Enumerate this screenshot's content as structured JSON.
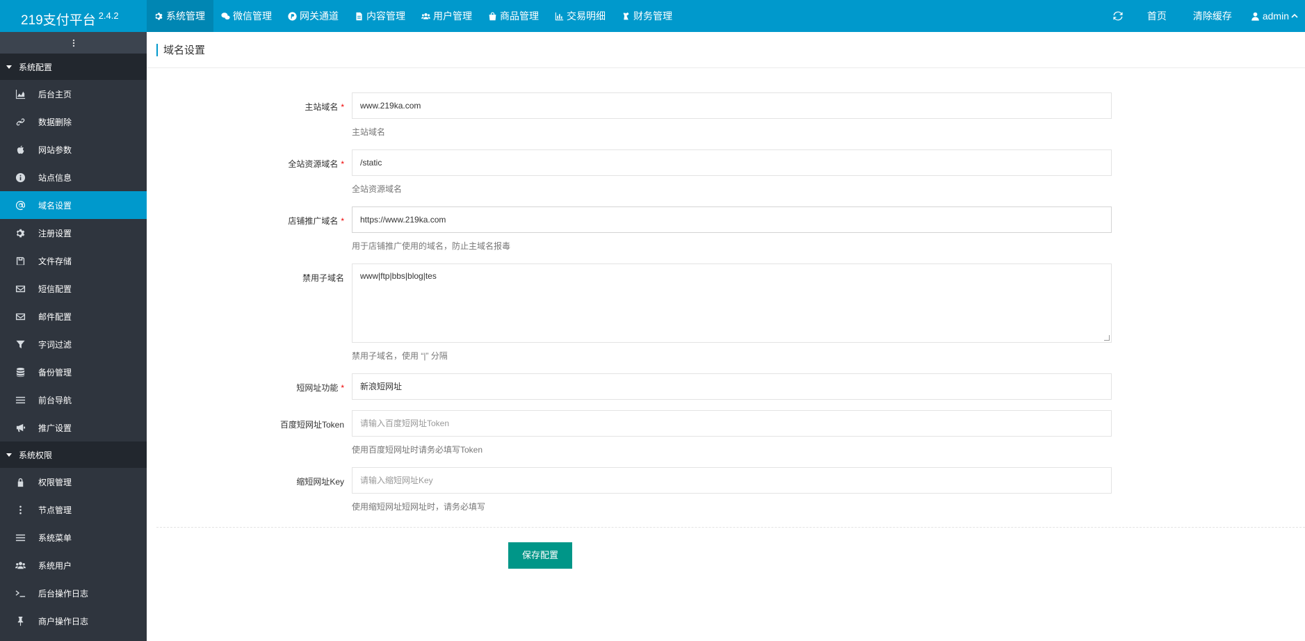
{
  "brand": {
    "name": "219支付平台",
    "version": "2.4.2"
  },
  "topnav": [
    {
      "label": "系统管理",
      "icon": "gear-icon",
      "active": true
    },
    {
      "label": "微信管理",
      "icon": "wechat-icon"
    },
    {
      "label": "网关通道",
      "icon": "paypal-icon"
    },
    {
      "label": "内容管理",
      "icon": "file-icon"
    },
    {
      "label": "用户管理",
      "icon": "users-icon"
    },
    {
      "label": "商品管理",
      "icon": "shopping-bag-icon"
    },
    {
      "label": "交易明细",
      "icon": "bar-chart-icon"
    },
    {
      "label": "财务管理",
      "icon": "flask-icon"
    }
  ],
  "topright": {
    "refresh_icon": "refresh-icon",
    "home": "首页",
    "clear_cache": "清除缓存",
    "user": "admin"
  },
  "sidebar": {
    "groups": [
      {
        "label": "系统配置",
        "items": [
          {
            "label": "后台主页",
            "icon": "area-chart-icon"
          },
          {
            "label": "数据删除",
            "icon": "chain-icon"
          },
          {
            "label": "网站参数",
            "icon": "apple-icon"
          },
          {
            "label": "站点信息",
            "icon": "info-circle-icon"
          },
          {
            "label": "域名设置",
            "icon": "at-icon",
            "active": true
          },
          {
            "label": "注册设置",
            "icon": "gear-icon"
          },
          {
            "label": "文件存储",
            "icon": "floppy-icon"
          },
          {
            "label": "短信配置",
            "icon": "envelope-icon"
          },
          {
            "label": "邮件配置",
            "icon": "envelope-icon"
          },
          {
            "label": "字词过滤",
            "icon": "filter-icon"
          },
          {
            "label": "备份管理",
            "icon": "database-icon"
          },
          {
            "label": "前台导航",
            "icon": "list-icon"
          },
          {
            "label": "推广设置",
            "icon": "bullhorn-icon"
          }
        ]
      },
      {
        "label": "系统权限",
        "items": [
          {
            "label": "权限管理",
            "icon": "lock-icon"
          },
          {
            "label": "节点管理",
            "icon": "ellipsis-vertical-icon"
          },
          {
            "label": "系统菜单",
            "icon": "list-icon"
          },
          {
            "label": "系统用户",
            "icon": "users-icon"
          },
          {
            "label": "后台操作日志",
            "icon": "terminal-icon"
          },
          {
            "label": "商户操作日志",
            "icon": "thumbtack-icon"
          }
        ]
      }
    ]
  },
  "page": {
    "title": "域名设置"
  },
  "form": {
    "main_domain": {
      "label": "主站域名",
      "value": "www.219ka.com",
      "help": "主站域名",
      "required": true
    },
    "static_domain": {
      "label": "全站资源域名",
      "value": "/static",
      "help": "全站资源域名",
      "required": true
    },
    "shop_domain": {
      "label": "店铺推广域名",
      "value": "https://www.219ka.com",
      "help": "用于店铺推广使用的域名，防止主域名报毒",
      "required": true
    },
    "banned_sub": {
      "label": "禁用子域名",
      "value": "www|ftp|bbs|blog|tes",
      "help": "禁用子域名，使用 “|” 分隔"
    },
    "short_url": {
      "label": "短网址功能",
      "value": "新浪短网址",
      "required": true
    },
    "baidu_token": {
      "label": "百度短网址Token",
      "placeholder": "请输入百度短网址Token",
      "help": "使用百度短网址时请务必填写Token"
    },
    "suo_key": {
      "label": "缩短网址Key",
      "placeholder": "请输入缩短网址Key",
      "help": "使用缩短网址短网址时，请务必填写"
    },
    "save_label": "保存配置"
  }
}
